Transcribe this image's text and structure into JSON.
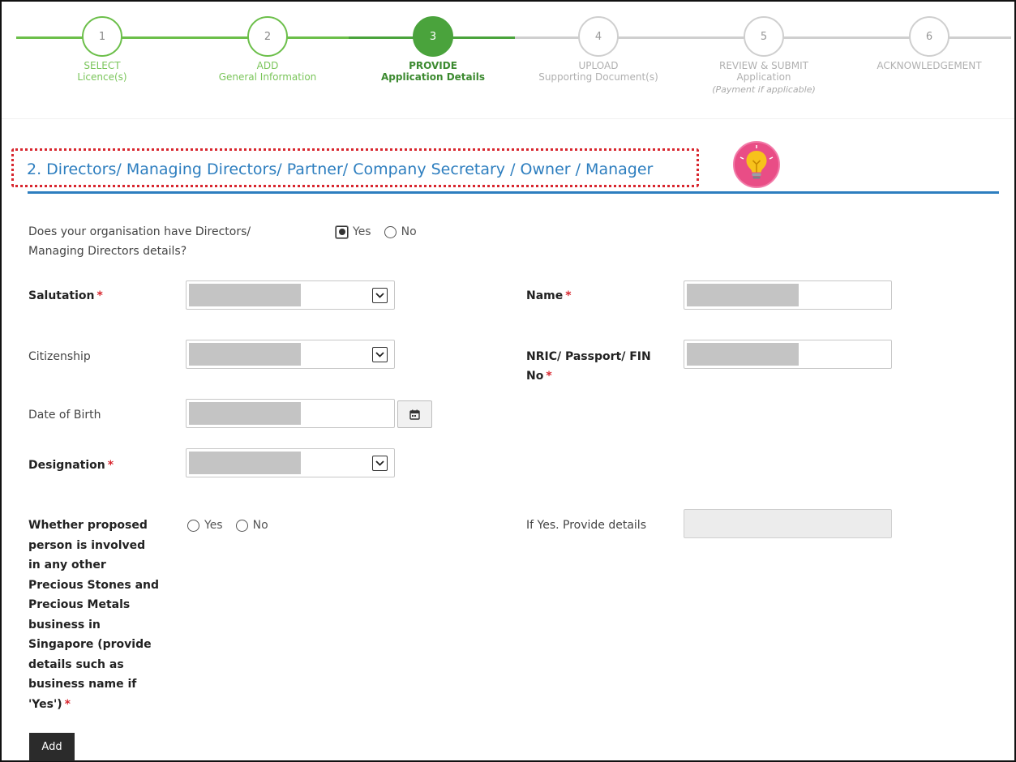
{
  "stepper": {
    "steps": [
      {
        "number": "1",
        "line1": "SELECT",
        "line2": "Licence(s)",
        "state": "done"
      },
      {
        "number": "2",
        "line1": "ADD",
        "line2": "General Information",
        "state": "done"
      },
      {
        "number": "3",
        "line1": "PROVIDE",
        "line2": "Application Details",
        "state": "current"
      },
      {
        "number": "4",
        "line1": "UPLOAD",
        "line2": "Supporting Document(s)",
        "state": "todo"
      },
      {
        "number": "5",
        "line1": "REVIEW & SUBMIT",
        "line2": "Application",
        "line3": "(Payment if applicable)",
        "state": "todo"
      },
      {
        "number": "6",
        "line1": "ACKNOWLEDGEMENT",
        "state": "todo"
      }
    ],
    "colors": {
      "done": "#6cbf4a",
      "current": "#4aa33c",
      "todo": "#cfcfcf"
    }
  },
  "section": {
    "title": "2. Directors/ Managing Directors/ Partner/ Company Secretary / Owner / Manager",
    "hint_icon": "lightbulb-icon",
    "accent": "#2d7ebf"
  },
  "form": {
    "has_directors": {
      "question_line1": "Does your organisation have Directors/",
      "question_line2": "Managing Directors details?",
      "options": [
        "Yes",
        "No"
      ],
      "selected": "Yes"
    },
    "salutation": {
      "label": "Salutation",
      "required": "*"
    },
    "name": {
      "label": "Name",
      "required": "*"
    },
    "citizenship": {
      "label": "Citizenship"
    },
    "nric": {
      "label_line1": "NRIC/ Passport/ FIN",
      "label_line2": "No",
      "required": "*"
    },
    "dob": {
      "label": "Date of Birth"
    },
    "designation": {
      "label": "Designation",
      "required": "*"
    },
    "involved": {
      "label_lines": [
        "Whether proposed",
        "person is involved",
        "in any other",
        "Precious Stones and",
        "Precious Metals",
        "business in",
        "Singapore (provide",
        "details such as",
        "business name if",
        "'Yes')"
      ],
      "required": "*",
      "options": [
        "Yes",
        "No"
      ],
      "selected": ""
    },
    "details": {
      "label": "If Yes. Provide details"
    },
    "add_button": "Add"
  }
}
